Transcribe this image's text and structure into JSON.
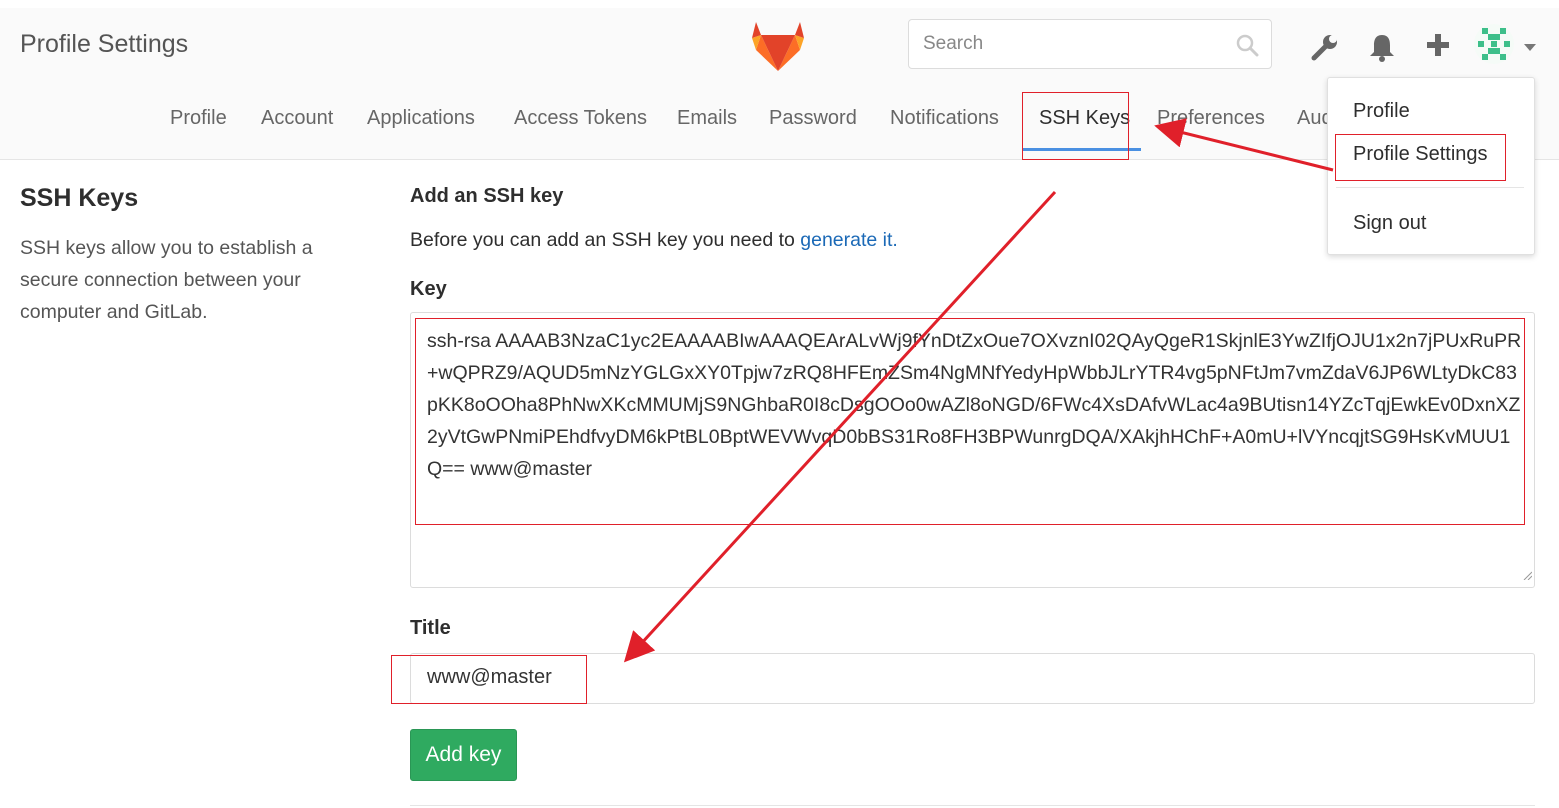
{
  "header": {
    "page_title": "Profile Settings",
    "search_placeholder": "Search",
    "icons": [
      "wrench-icon",
      "bell-icon",
      "plus-icon",
      "avatar"
    ]
  },
  "tabs": [
    {
      "label": "Profile"
    },
    {
      "label": "Account"
    },
    {
      "label": "Applications"
    },
    {
      "label": "Access Tokens"
    },
    {
      "label": "Emails"
    },
    {
      "label": "Password"
    },
    {
      "label": "Notifications"
    },
    {
      "label": "SSH Keys",
      "active": true
    },
    {
      "label": "Preferences"
    },
    {
      "label": "Aud"
    }
  ],
  "sidebar": {
    "title": "SSH Keys",
    "description": "SSH keys allow you to establish a secure connection between your computer and GitLab."
  },
  "form": {
    "heading": "Add an SSH key",
    "intro": "Before you can add an SSH key you need to ",
    "intro_link": "generate it.",
    "key_label": "Key",
    "key_value": "ssh-rsa AAAAB3NzaC1yc2EAAAABIwAAAQEArALvWj9fYnDtZxOue7OXvznI02QAyQgeR1SkjnlE3YwZIfjOJU1x2n7jPUxRuPR+wQPRZ9/AQUD5mNzYGLGxXY0Tpjw7zRQ8HFEmZSm4NgMNfYedyHpWbbJLrYTR4vg5pNFtJm7vmZdaV6JP6WLtyDkC83pKK8oOOha8PhNwXKcMMUMjS9NGhbaR0I8cDsgOOo0wAZl8oNGD/6FWc4XsDAfvWLac4a9BUtisn14YZcTqjEwkEv0DxnXZ2yVtGwPNmiPEhdfvyDM6kPtBL0BptWEVWvqD0bBS31Ro8FH3BPWunrgDQA/XAkjhHChF+A0mU+lVYncqjtSG9HsKvMUU1Q== www@master",
    "title_label": "Title",
    "title_value": "www@master",
    "submit_label": "Add key"
  },
  "dropdown": {
    "items": [
      "Profile",
      "Profile Settings",
      "Sign out"
    ]
  },
  "colors": {
    "accent_blue": "#4a90e2",
    "button_green": "#2faa60",
    "link_blue": "#1b69b6",
    "annotation_red": "#e0202a"
  }
}
